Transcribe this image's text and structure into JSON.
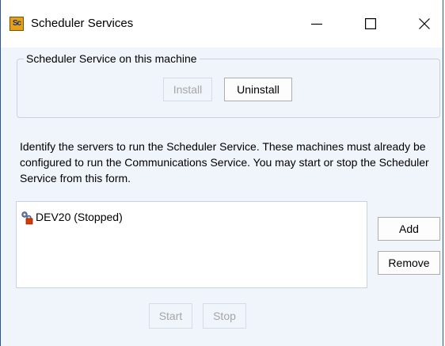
{
  "window": {
    "title": "Scheduler Services",
    "icon_text": "Sc"
  },
  "service_group": {
    "legend": "Scheduler Service on this machine",
    "install_label": "Install",
    "uninstall_label": "Uninstall"
  },
  "description": "Identify the servers to run the Scheduler Service. These machines must already be configured to run the Communications Service. You may start or stop the Scheduler Service from this form.",
  "servers": {
    "items": [
      {
        "label": "DEV20 (Stopped)",
        "icon": "server-stopped-icon"
      }
    ]
  },
  "actions": {
    "add_label": "Add",
    "remove_label": "Remove",
    "start_label": "Start",
    "stop_label": "Stop"
  },
  "colors": {
    "window_border": "#2b579a",
    "client_background": "#f0f5fb",
    "disabled_text": "#a6a6a6"
  }
}
